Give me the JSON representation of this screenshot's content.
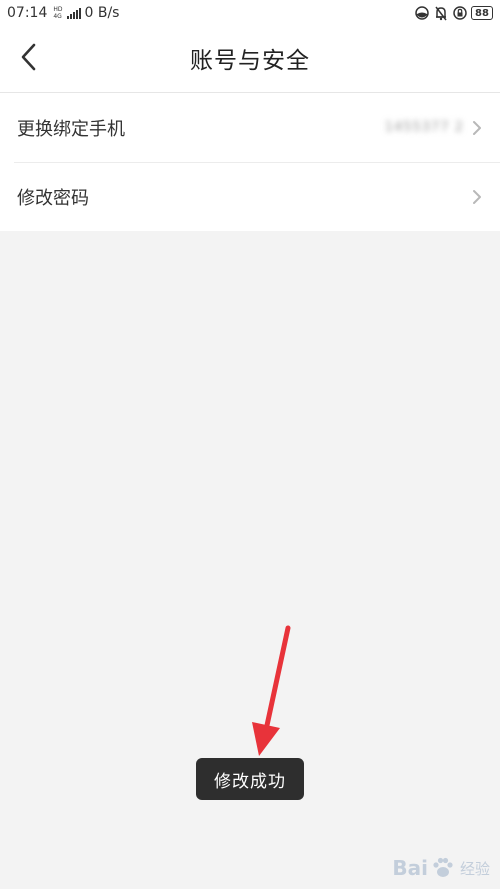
{
  "status_bar": {
    "time": "07:14",
    "network_type": "4G",
    "network_sub": "HD",
    "speed": "0 B/s",
    "battery": "88",
    "icons": [
      "data-saver-icon",
      "bell-muted-icon",
      "lock-rotation-icon",
      "battery-icon"
    ]
  },
  "header": {
    "back_icon": "chevron-left-icon",
    "title": "账号与安全"
  },
  "menu": {
    "items": [
      {
        "label": "更换绑定手机",
        "value": "1455377 2",
        "icon": "chevron-right-icon"
      },
      {
        "label": "修改密码",
        "icon": "chevron-right-icon"
      }
    ]
  },
  "toast": {
    "text": "修改成功"
  },
  "watermark": {
    "brand": "Bai",
    "sub": "经验",
    "icon": "paw-icon"
  },
  "colors": {
    "background": "#f3f3f3",
    "surface": "#ffffff",
    "text_primary": "#333333",
    "toast_bg": "#2e2e2e",
    "annotation_arrow": "#e8333a"
  }
}
